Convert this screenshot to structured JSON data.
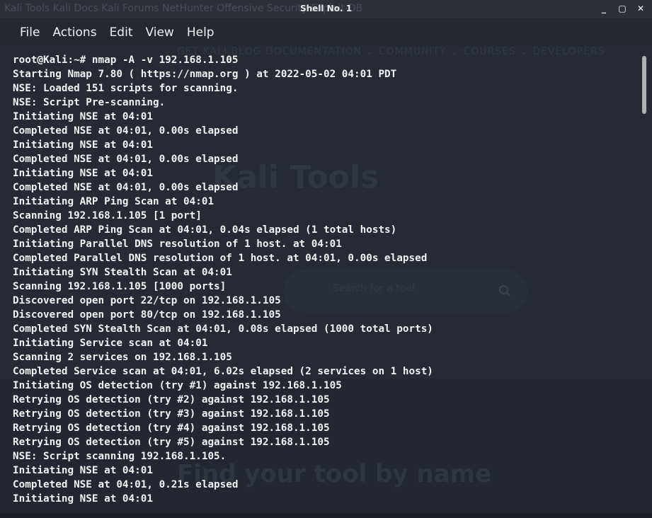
{
  "window": {
    "title": "Shell No. 1",
    "controls": {
      "minimize": "_",
      "maximize": "▢",
      "close": "✕"
    },
    "background_bookmarks": "Kali Tools   Kali Docs   Kali Forums   NetHunter   Offensive Security   Exploit-DB"
  },
  "menu": {
    "items": [
      "File",
      "Actions",
      "Edit",
      "View",
      "Help"
    ]
  },
  "background_site": {
    "nav": "GET KALI   BLOG   DOCUMENTATION ⌄   COMMUNITY ⌄   COURSES ⌄   DEVELOPERS",
    "heading": "Kali Tools",
    "search_placeholder": "Search for a tool",
    "find_text": "Find your tool by name"
  },
  "terminal": {
    "lines": [
      "root@Kali:~# nmap -A -v 192.168.1.105",
      "Starting Nmap 7.80 ( https://nmap.org ) at 2022-05-02 04:01 PDT",
      "NSE: Loaded 151 scripts for scanning.",
      "NSE: Script Pre-scanning.",
      "Initiating NSE at 04:01",
      "Completed NSE at 04:01, 0.00s elapsed",
      "Initiating NSE at 04:01",
      "Completed NSE at 04:01, 0.00s elapsed",
      "Initiating NSE at 04:01",
      "Completed NSE at 04:01, 0.00s elapsed",
      "Initiating ARP Ping Scan at 04:01",
      "Scanning 192.168.1.105 [1 port]",
      "Completed ARP Ping Scan at 04:01, 0.04s elapsed (1 total hosts)",
      "Initiating Parallel DNS resolution of 1 host. at 04:01",
      "Completed Parallel DNS resolution of 1 host. at 04:01, 0.00s elapsed",
      "Initiating SYN Stealth Scan at 04:01",
      "Scanning 192.168.1.105 [1000 ports]",
      "Discovered open port 22/tcp on 192.168.1.105",
      "Discovered open port 80/tcp on 192.168.1.105",
      "Completed SYN Stealth Scan at 04:01, 0.08s elapsed (1000 total ports)",
      "Initiating Service scan at 04:01",
      "Scanning 2 services on 192.168.1.105",
      "Completed Service scan at 04:01, 6.02s elapsed (2 services on 1 host)",
      "Initiating OS detection (try #1) against 192.168.1.105",
      "Retrying OS detection (try #2) against 192.168.1.105",
      "Retrying OS detection (try #3) against 192.168.1.105",
      "Retrying OS detection (try #4) against 192.168.1.105",
      "Retrying OS detection (try #5) against 192.168.1.105",
      "NSE: Script scanning 192.168.1.105.",
      "Initiating NSE at 04:01",
      "Completed NSE at 04:01, 0.21s elapsed",
      "Initiating NSE at 04:01"
    ]
  },
  "colors": {
    "terminal_bg": "#252a34",
    "text": "#f2f2f2",
    "menubar_bg": "#242830",
    "titlebar_bg": "#2c3039"
  },
  "icons": [
    "search-icon"
  ]
}
